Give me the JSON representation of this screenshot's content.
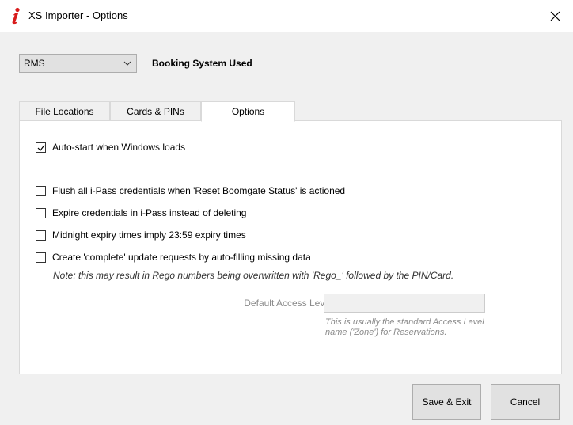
{
  "window": {
    "title": "XS Importer - Options",
    "close_icon": "close-icon",
    "app_icon": "info-i-icon",
    "accent": "#d81b1b"
  },
  "booking": {
    "selected": "RMS",
    "label": "Booking System Used"
  },
  "tabs": [
    {
      "label": "File Locations",
      "active": false
    },
    {
      "label": "Cards & PINs",
      "active": false
    },
    {
      "label": "Options",
      "active": true
    }
  ],
  "options": {
    "autostart": {
      "label": "Auto-start when Windows loads",
      "checked": true
    },
    "flush": {
      "label": "Flush all i-Pass credentials when 'Reset Boomgate Status' is actioned",
      "checked": false
    },
    "expire": {
      "label": "Expire credentials in i-Pass instead of deleting",
      "checked": false
    },
    "midnight": {
      "label": "Midnight expiry times imply 23:59 expiry times",
      "checked": false
    },
    "complete": {
      "label": "Create 'complete' update requests by auto-filling missing data",
      "checked": false
    },
    "complete_note": "Note: this may result in Rego numbers being overwritten with 'Rego_' followed by the PIN/Card.",
    "default_access": {
      "label": "Default Access Level:",
      "value": "",
      "hint": "This is usually the standard Access Level name ('Zone') for Reservations."
    }
  },
  "buttons": {
    "save": "Save & Exit",
    "cancel": "Cancel"
  }
}
